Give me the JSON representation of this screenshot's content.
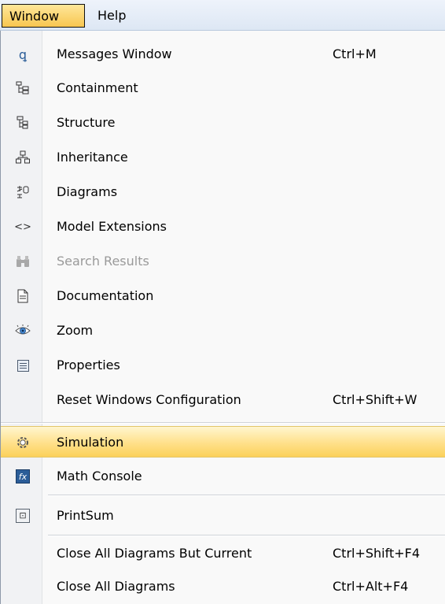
{
  "menubar": {
    "items": [
      {
        "label": "Window",
        "active": true
      },
      {
        "label": "Help",
        "active": false
      }
    ]
  },
  "menu": {
    "items": [
      {
        "icon": "lightbulb-icon",
        "label": "Messages Window",
        "shortcut": "Ctrl+M"
      },
      {
        "icon": "containment-tree-icon",
        "label": "Containment",
        "shortcut": ""
      },
      {
        "icon": "structure-tree-icon",
        "label": "Structure",
        "shortcut": ""
      },
      {
        "icon": "inheritance-icon",
        "label": "Inheritance",
        "shortcut": ""
      },
      {
        "icon": "diagrams-icon",
        "label": "Diagrams",
        "shortcut": ""
      },
      {
        "icon": "angle-brackets-icon",
        "label": "Model Extensions",
        "shortcut": ""
      },
      {
        "icon": "binoculars-icon",
        "label": "Search Results",
        "shortcut": "",
        "disabled": true
      },
      {
        "icon": "document-icon",
        "label": "Documentation",
        "shortcut": ""
      },
      {
        "icon": "eye-icon",
        "label": "Zoom",
        "shortcut": ""
      },
      {
        "icon": "properties-icon",
        "label": "Properties",
        "shortcut": ""
      },
      {
        "icon": "",
        "label": "Reset Windows Configuration",
        "shortcut": "Ctrl+Shift+W"
      },
      {
        "icon": "gear-icon",
        "label": "Simulation",
        "shortcut": "",
        "highlighted": true
      },
      {
        "icon": "fx-icon",
        "label": "Math Console",
        "shortcut": ""
      },
      {
        "icon": "printsum-icon",
        "label": "PrintSum",
        "shortcut": ""
      },
      {
        "icon": "",
        "label": "Close All Diagrams But Current",
        "shortcut": "Ctrl+Shift+F4"
      },
      {
        "icon": "",
        "label": "Close All Diagrams",
        "shortcut": "Ctrl+Alt+F4"
      }
    ]
  },
  "icons": {
    "lightbulb": "💡",
    "containment": "⊩",
    "structure": "⊫",
    "inheritance": "品",
    "diagrams": "⁂",
    "angle_brackets": "<>",
    "binoculars": "⚇",
    "document": "🗎",
    "eye": "◉",
    "gear": "⚙"
  },
  "colors": {
    "highlight": "#ffe08a",
    "menubar": "#dde7f4",
    "disabled_text": "#9a9a9a"
  }
}
